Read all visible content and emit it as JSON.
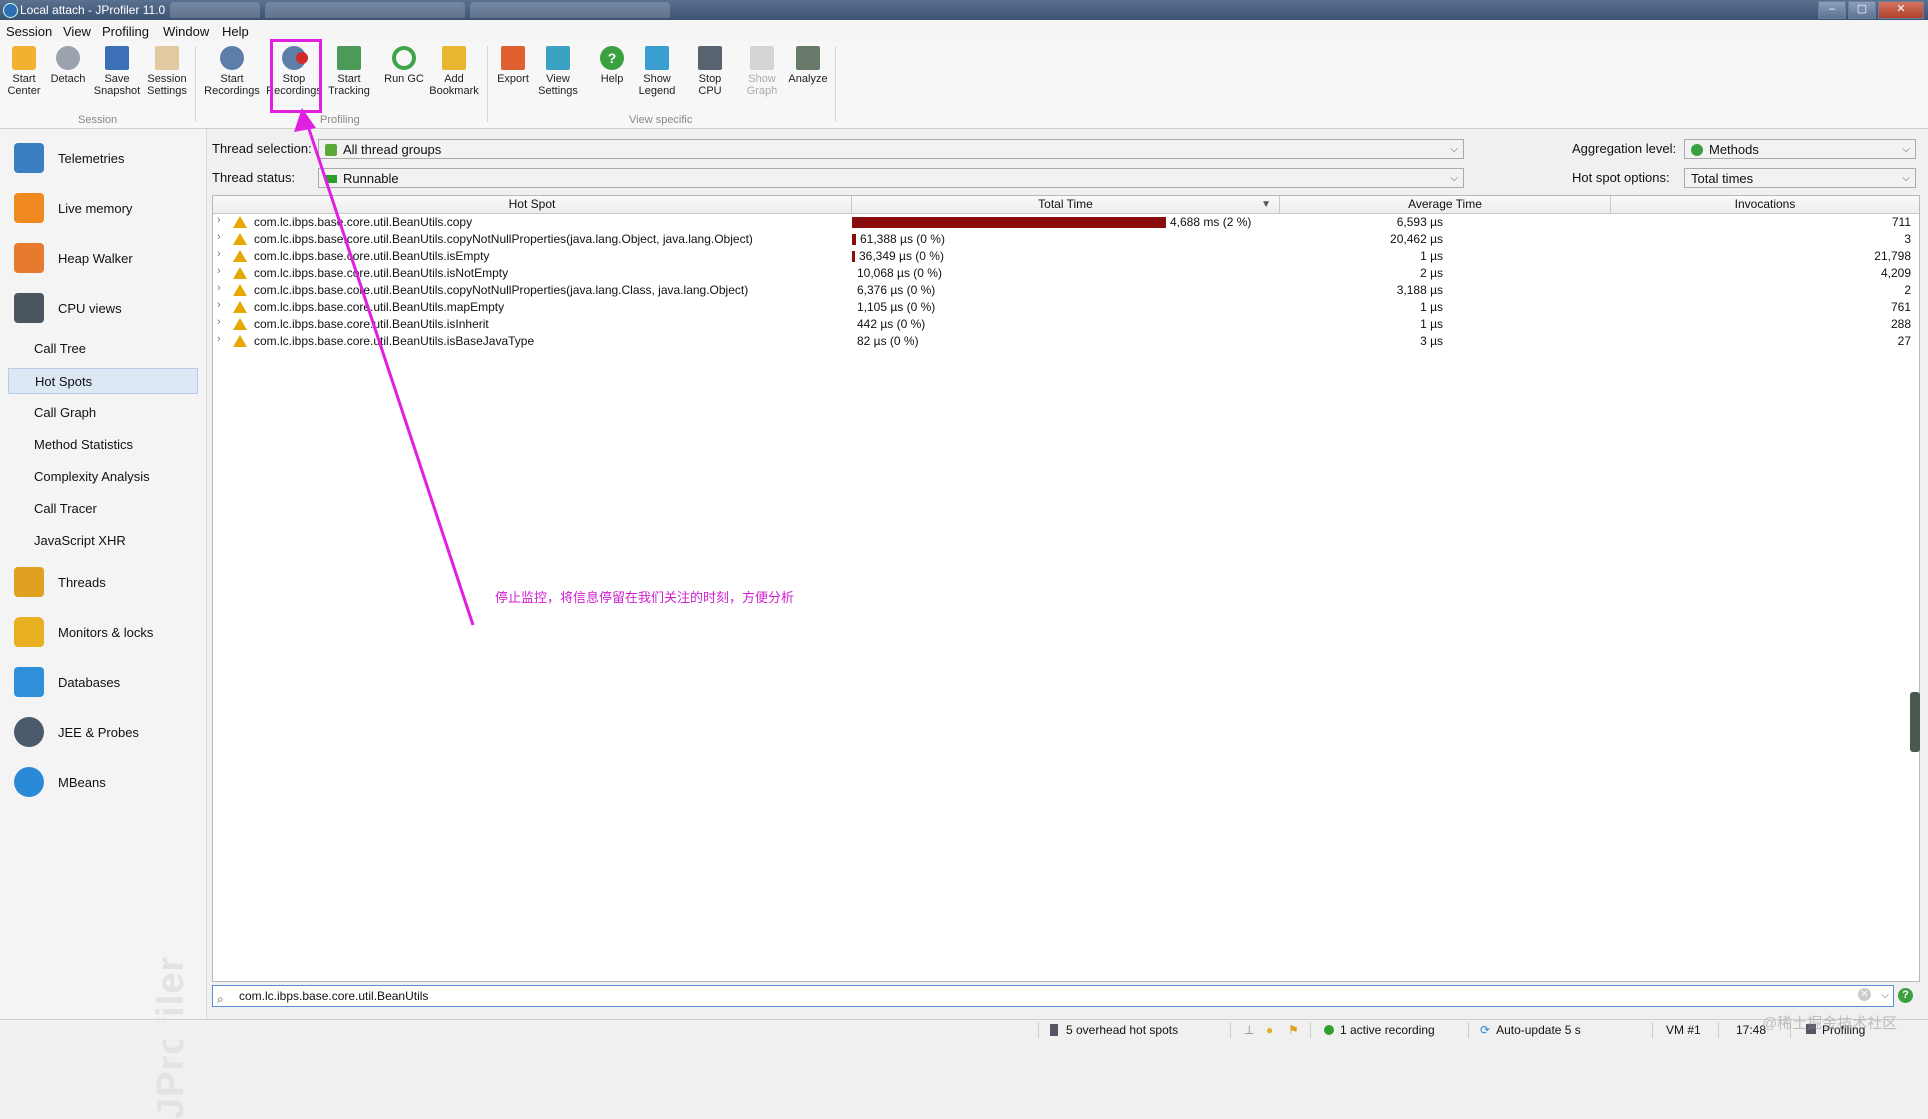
{
  "window": {
    "title": "Local attach - JProfiler 11.0"
  },
  "menu": [
    "Session",
    "View",
    "Profiling",
    "Window",
    "Help"
  ],
  "toolbar": {
    "buttons": [
      {
        "l1": "Start",
        "l2": "Center"
      },
      {
        "l1": "",
        "l2": "Detach"
      },
      {
        "l1": "Save",
        "l2": "Snapshot"
      },
      {
        "l1": "Session",
        "l2": "Settings"
      },
      {
        "l1": "Start",
        "l2": "Recordings"
      },
      {
        "l1": "Stop",
        "l2": "Recordings"
      },
      {
        "l1": "Start",
        "l2": "Tracking"
      },
      {
        "l1": "",
        "l2": "Run GC"
      },
      {
        "l1": "Add",
        "l2": "Bookmark"
      },
      {
        "l1": "",
        "l2": "Export"
      },
      {
        "l1": "View",
        "l2": "Settings"
      },
      {
        "l1": "",
        "l2": "Help"
      },
      {
        "l1": "Show",
        "l2": "Legend"
      },
      {
        "l1": "Stop",
        "l2": "CPU"
      },
      {
        "l1": "Show",
        "l2": "Graph"
      },
      {
        "l1": "",
        "l2": "Analyze"
      }
    ],
    "groups": {
      "session": "Session",
      "profiling": "Profiling",
      "view_specific": "View specific"
    }
  },
  "sidebar": {
    "sections": [
      "Telemetries",
      "Live memory",
      "Heap Walker",
      "CPU views",
      "Threads",
      "Monitors & locks",
      "Databases",
      "JEE & Probes",
      "MBeans"
    ],
    "cpu_subitems": [
      "Call Tree",
      "Hot Spots",
      "Call Graph",
      "Method Statistics",
      "Complexity Analysis",
      "Call Tracer",
      "JavaScript XHR"
    ],
    "active_subitem": "Hot Spots",
    "watermark": "JProfiler"
  },
  "filters": {
    "thread_selection_label": "Thread selection:",
    "thread_selection_value": "All thread groups",
    "thread_status_label": "Thread status:",
    "thread_status_value": "Runnable",
    "aggregation_label": "Aggregation level:",
    "aggregation_value": "Methods",
    "hotspot_options_label": "Hot spot options:",
    "hotspot_options_value": "Total times"
  },
  "table": {
    "columns": [
      "Hot Spot",
      "Total Time",
      "Average Time",
      "Invocations"
    ],
    "rows": [
      {
        "name": "com.lc.ibps.base.core.util.BeanUtils.copy",
        "total": "4,688 ms (2 %)",
        "bar": 1.0,
        "avg": "6,593 µs",
        "inv": "711"
      },
      {
        "name": "com.lc.ibps.base.core.util.BeanUtils.copyNotNullProperties(java.lang.Object, java.lang.Object)",
        "total": "61,388 µs (0 %)",
        "bar": 0.013,
        "avg": "20,462 µs",
        "inv": "3"
      },
      {
        "name": "com.lc.ibps.base.core.util.BeanUtils.isEmpty",
        "total": "36,349 µs (0 %)",
        "bar": 0.008,
        "avg": "1 µs",
        "inv": "21,798"
      },
      {
        "name": "com.lc.ibps.base.core.util.BeanUtils.isNotEmpty",
        "total": "10,068 µs (0 %)",
        "bar": 0,
        "avg": "2 µs",
        "inv": "4,209"
      },
      {
        "name": "com.lc.ibps.base.core.util.BeanUtils.copyNotNullProperties(java.lang.Class, java.lang.Object)",
        "total": "6,376 µs (0 %)",
        "bar": 0,
        "avg": "3,188 µs",
        "inv": "2"
      },
      {
        "name": "com.lc.ibps.base.core.util.BeanUtils.mapEmpty",
        "total": "1,105 µs (0 %)",
        "bar": 0,
        "avg": "1 µs",
        "inv": "761"
      },
      {
        "name": "com.lc.ibps.base.core.util.BeanUtils.isInherit",
        "total": "442 µs (0 %)",
        "bar": 0,
        "avg": "1 µs",
        "inv": "288"
      },
      {
        "name": "com.lc.ibps.base.core.util.BeanUtils.isBaseJavaType",
        "total": "82 µs (0 %)",
        "bar": 0,
        "avg": "3 µs",
        "inv": "27"
      }
    ]
  },
  "annotation": "停止监控，将信息停留在我们关注的时刻，方便分析",
  "search": {
    "value": "com.lc.ibps.base.core.util.BeanUtils"
  },
  "status": {
    "overhead": "5 overhead hot spots",
    "recording": "1 active recording",
    "autoupdate": "Auto-update 5 s",
    "vm": "VM #1",
    "time": "17:48",
    "mode": "Profiling"
  },
  "credit": "@稀土掘金技术社区",
  "colors": {
    "accent": "#e020e0",
    "bar": "#8b0c0c",
    "selection": "#dde8f5"
  }
}
